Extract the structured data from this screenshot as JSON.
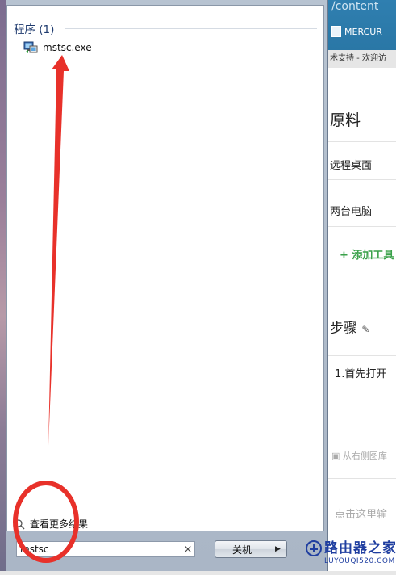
{
  "start_menu": {
    "section_title": "程序 (1)",
    "results": [
      {
        "name": "mstsc.exe",
        "icon": "remote-desktop-icon"
      }
    ],
    "see_more": "查看更多结果",
    "search": {
      "value": "mstsc"
    },
    "shutdown_label": "关机"
  },
  "background_page": {
    "url_fragment": "/content",
    "tab_title": "MERCUR",
    "subbar_text": "术支持 - 欢迎访",
    "heading_materials": "原料",
    "item_remote_desktop": "远程桌面",
    "item_two_computers": "两台电脑",
    "add_tool": "+ 添加工具",
    "heading_steps": "步骤",
    "step_1": "1.首先打开",
    "image_hint": "从右侧图库",
    "click_hint": "点击这里输"
  },
  "watermark": {
    "title": "路由器之家",
    "url": "LUYOUQI520.COM"
  },
  "colors": {
    "annotation_red": "#e8312a",
    "link_blue": "#1e3a6e",
    "header_blue": "#2f7fb0"
  }
}
